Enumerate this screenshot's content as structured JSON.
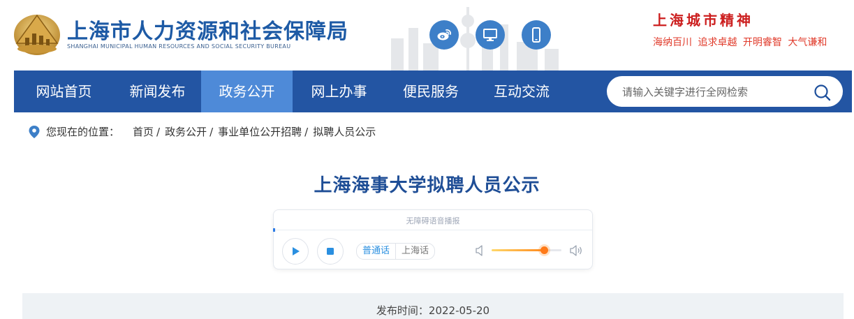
{
  "header": {
    "org_name": "上海市人力资源和社会保障局",
    "org_name_en": "SHANGHAI MUNICIPAL HUMAN RESOURCES AND SOCIAL SECURITY BUREAU",
    "icons": [
      "weibo-icon",
      "desktop-icon",
      "mobile-icon"
    ],
    "spirit_title": "上海城市精神",
    "spirit_words": "海纳百川 追求卓越 开明睿智 大气谦和"
  },
  "nav": {
    "items": [
      "网站首页",
      "新闻发布",
      "政务公开",
      "网上办事",
      "便民服务",
      "互动交流"
    ],
    "active": "政务公开",
    "search_placeholder": "请输入关键字进行全网检索"
  },
  "breadcrumb": {
    "label": "您现在的位置：",
    "items": [
      "首页",
      "政务公开",
      "事业单位公开招聘",
      "拟聘人员公示"
    ],
    "separator": "/"
  },
  "article": {
    "title": "上海海事大学拟聘人员公示",
    "publish_label": "发布时间：",
    "publish_date": "2022-05-20"
  },
  "player": {
    "label": "无障碍语音播报",
    "languages": [
      "普通话",
      "上海话"
    ],
    "selected_language": "普通话",
    "volume": 0.75
  },
  "colors": {
    "nav_bg": "#2355a3",
    "nav_active": "#4e8ad8",
    "title": "#1f4e96",
    "spirit_red": "#cc1e1e",
    "accent_blue": "#2a8fe0"
  }
}
